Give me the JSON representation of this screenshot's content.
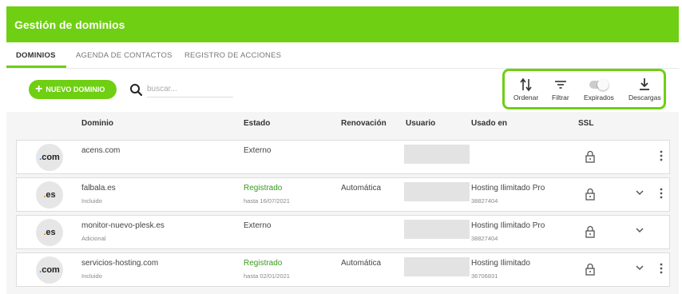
{
  "header": {
    "title": "Gestión de dominios"
  },
  "tabs": [
    {
      "label": "DOMINIOS"
    },
    {
      "label": "AGENDA DE CONTACTOS"
    },
    {
      "label": "REGISTRO DE ACCIONES"
    }
  ],
  "toolbar": {
    "new_label": "NUEVO DOMINIO",
    "search_placeholder": "buscar...",
    "actions": {
      "sort": "Ordenar",
      "filter": "Filtrar",
      "expired": "Expirados",
      "download": "Descargas"
    },
    "expired_toggle_on": false
  },
  "columns": {
    "domain": "Dominio",
    "status": "Estado",
    "renewal": "Renovación",
    "user": "Usuario",
    "used_in": "Usado en",
    "ssl": "SSL"
  },
  "rows": [
    {
      "tld": "com",
      "domain": "acens.com",
      "domain_sub": "",
      "status": "Externo",
      "status_sub": "",
      "renewal": "",
      "used_in": "",
      "used_in_sub": ""
    },
    {
      "tld": "es",
      "domain": "falbala.es",
      "domain_sub": "Incluido",
      "status": "Registrado",
      "status_sub": "hasta 16/07/2021",
      "renewal": "Automática",
      "used_in": "Hosting Ilimitado Pro",
      "used_in_sub": "38827404"
    },
    {
      "tld": "es",
      "domain": "monitor-nuevo-plesk.es",
      "domain_sub": "Adicional",
      "status": "Externo",
      "status_sub": "",
      "renewal": "",
      "used_in": "Hosting Ilimitado Pro",
      "used_in_sub": "38827404"
    },
    {
      "tld": "com",
      "domain": "servicios-hosting.com",
      "domain_sub": "Incluido",
      "status": "Registrado",
      "status_sub": "hasta 02/01/2021",
      "renewal": "Automática",
      "used_in": "Hosting Ilimitado",
      "used_in_sub": "36706831"
    }
  ],
  "colors": {
    "accent": "#6fcf13",
    "status_green": "#3a9a1f"
  }
}
